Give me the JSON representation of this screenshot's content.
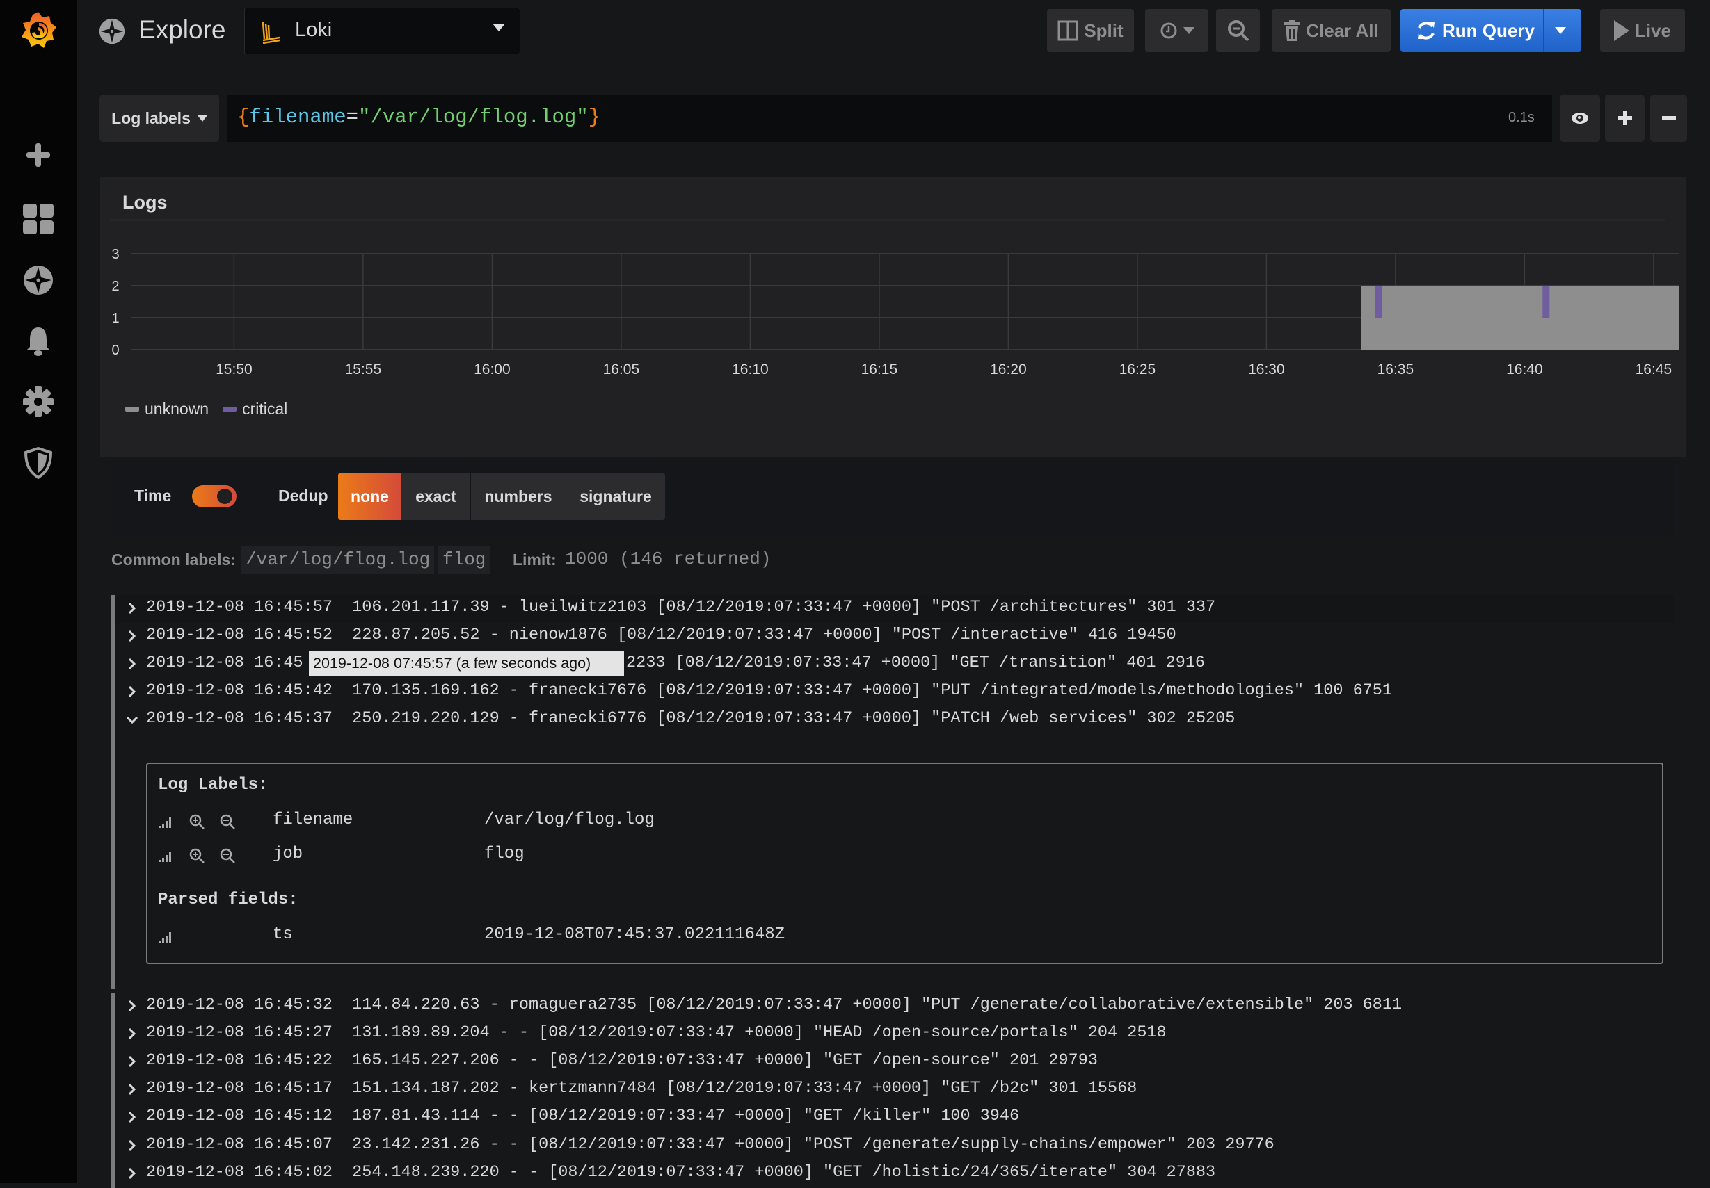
{
  "header": {
    "title": "Explore",
    "datasource": "Loki",
    "buttons": {
      "split": "Split",
      "clear_all": "Clear All",
      "run_query": "Run Query",
      "live": "Live"
    }
  },
  "query": {
    "selector_label": "Log labels",
    "open_brace": "{",
    "key": "filename",
    "eq": "=",
    "value": "\"/var/log/flog.log\"",
    "close_brace": "}",
    "duration": "0.1s"
  },
  "panel": {
    "title": "Logs"
  },
  "chart_data": {
    "type": "bar",
    "stacked": true,
    "x_range": [
      "15:46",
      "16:46"
    ],
    "x_ticks": [
      "15:50",
      "15:55",
      "16:00",
      "16:05",
      "16:10",
      "16:15",
      "16:20",
      "16:25",
      "16:30",
      "16:35",
      "16:40",
      "16:45"
    ],
    "y_range": [
      0,
      3
    ],
    "y_ticks": [
      0,
      1,
      2,
      3
    ],
    "grid": true,
    "legend_placement": "bottom-left",
    "series": [
      {
        "name": "unknown",
        "color": "#8e8e8e",
        "segments": [
          {
            "from": "16:33:40",
            "to": "16:46:00",
            "value": 2
          }
        ]
      },
      {
        "name": "critical",
        "color": "#705da0",
        "points": [
          {
            "t": "16:34:20",
            "value": 1
          },
          {
            "t": "16:40:50",
            "value": 1
          }
        ]
      }
    ]
  },
  "options": {
    "time_label": "Time",
    "time_enabled": true,
    "dedup_label": "Dedup",
    "dedup": [
      "none",
      "exact",
      "numbers",
      "signature"
    ],
    "dedup_selected": "none"
  },
  "meta": {
    "common_labels_label": "Common labels:",
    "common_labels": [
      "/var/log/flog.log",
      "flog"
    ],
    "limit_label": "Limit:",
    "limit_value": "1000 (146 returned)"
  },
  "tooltip": "2019-12-08 07:45:57 (a few seconds ago)",
  "rows_top": [
    {
      "text": "2019-12-08 16:45:57  106.201.117.39 - lueilwitz2103 [08/12/2019:07:33:47 +0000] \"POST /architectures\" 301 337"
    },
    {
      "text": "2019-12-08 16:45:52  228.87.205.52 - nienow1876 [08/12/2019:07:33:47 +0000] \"POST /interactive\" 416 19450"
    },
    {
      "text": "2019-12-08 16:45",
      "after_tooltip": "2233 [08/12/2019:07:33:47 +0000] \"GET /transition\" 401 2916"
    },
    {
      "text": "2019-12-08 16:45:42  170.135.169.162 - franecki7676 [08/12/2019:07:33:47 +0000] \"PUT /integrated/models/methodologies\" 100 6751"
    },
    {
      "text": "2019-12-08 16:45:37  250.219.220.129 - franecki6776 [08/12/2019:07:33:47 +0000] \"PATCH /web services\" 302 25205"
    }
  ],
  "details": {
    "labels_title": "Log Labels:",
    "labels": [
      {
        "key": "filename",
        "value": "/var/log/flog.log"
      },
      {
        "key": "job",
        "value": "flog"
      }
    ],
    "parsed_title": "Parsed fields:",
    "parsed": [
      {
        "key": "ts",
        "value": "2019-12-08T07:45:37.022111648Z"
      }
    ]
  },
  "rows_bottom": [
    {
      "text": "2019-12-08 16:45:32  114.84.220.63 - romaguera2735 [08/12/2019:07:33:47 +0000] \"PUT /generate/collaborative/extensible\" 203 6811"
    },
    {
      "text": "2019-12-08 16:45:27  131.189.89.204 - - [08/12/2019:07:33:47 +0000] \"HEAD /open-source/portals\" 204 2518"
    },
    {
      "text": "2019-12-08 16:45:22  165.145.227.206 - - [08/12/2019:07:33:47 +0000] \"GET /open-source\" 201 29793"
    },
    {
      "text": "2019-12-08 16:45:17  151.134.187.202 - kertzmann7484 [08/12/2019:07:33:47 +0000] \"GET /b2c\" 301 15568"
    },
    {
      "text": "2019-12-08 16:45:12  187.81.43.114 - - [08/12/2019:07:33:47 +0000] \"GET /killer\" 100 3946"
    },
    {
      "text": "2019-12-08 16:45:07  23.142.231.26 - - [08/12/2019:07:33:47 +0000] \"POST /generate/supply-chains/empower\" 203 29776"
    },
    {
      "text": "2019-12-08 16:45:02  254.148.239.220 - - [08/12/2019:07:33:47 +0000] \"GET /holistic/24/365/iterate\" 304 27883"
    }
  ],
  "colors": {
    "accent_blue": "#3274d9",
    "accent_orange": "#eb7b18",
    "background": "#161719",
    "panel": "#212124"
  }
}
